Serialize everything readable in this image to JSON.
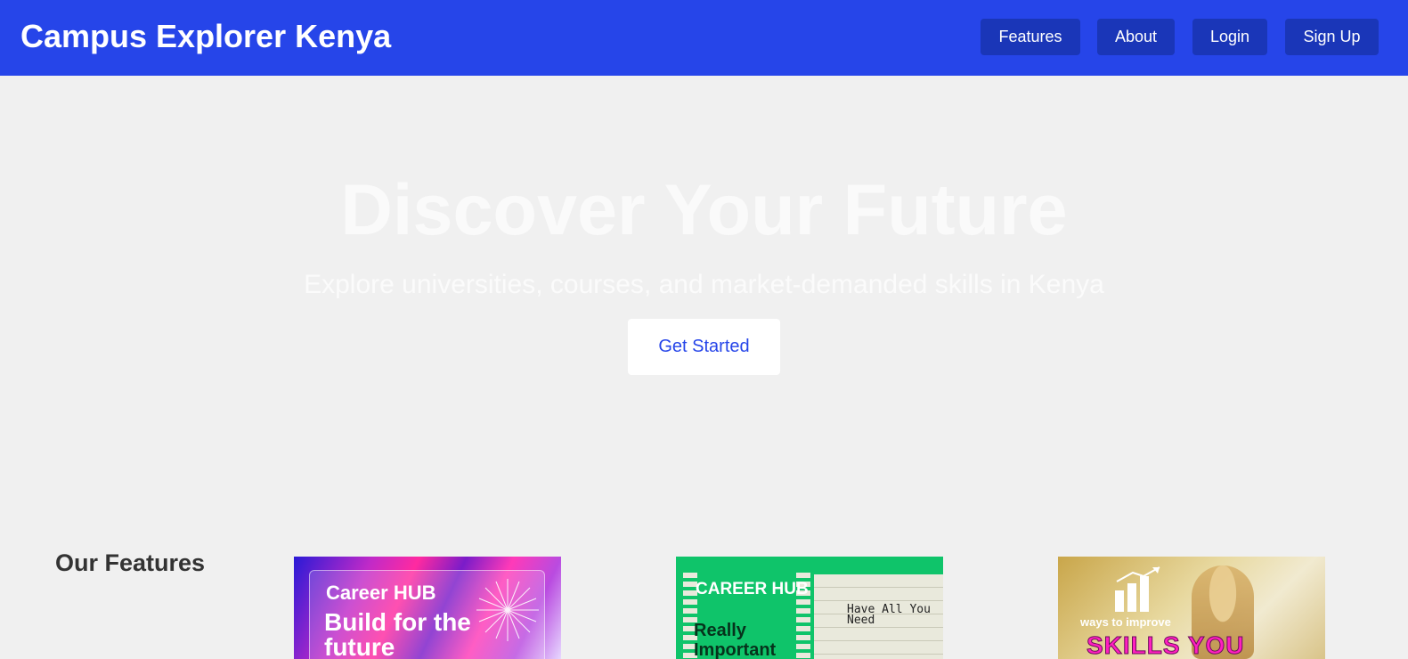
{
  "header": {
    "brand": "Campus Explorer Kenya",
    "nav": [
      {
        "label": "Features"
      },
      {
        "label": "About"
      },
      {
        "label": "Login"
      },
      {
        "label": "Sign Up"
      }
    ]
  },
  "hero": {
    "title": "Discover Your Future",
    "subtitle": "Explore universities, courses, and market-demanded skills in Kenya",
    "cta_label": "Get Started"
  },
  "features": {
    "title": "Our Features",
    "cards": [
      {
        "line1": "Career HUB",
        "line2": "Build for the future"
      },
      {
        "line1": "CAREER HUB",
        "line2": "Really Important",
        "line3": "Have All You Need"
      },
      {
        "line1": "ways to improve",
        "line2": "SKILLS YOU"
      }
    ]
  },
  "colors": {
    "navbar": "#2645e9",
    "nav_button": "#1a36b8",
    "page_background": "#f0f0f0",
    "cta_text": "#2645e9"
  }
}
